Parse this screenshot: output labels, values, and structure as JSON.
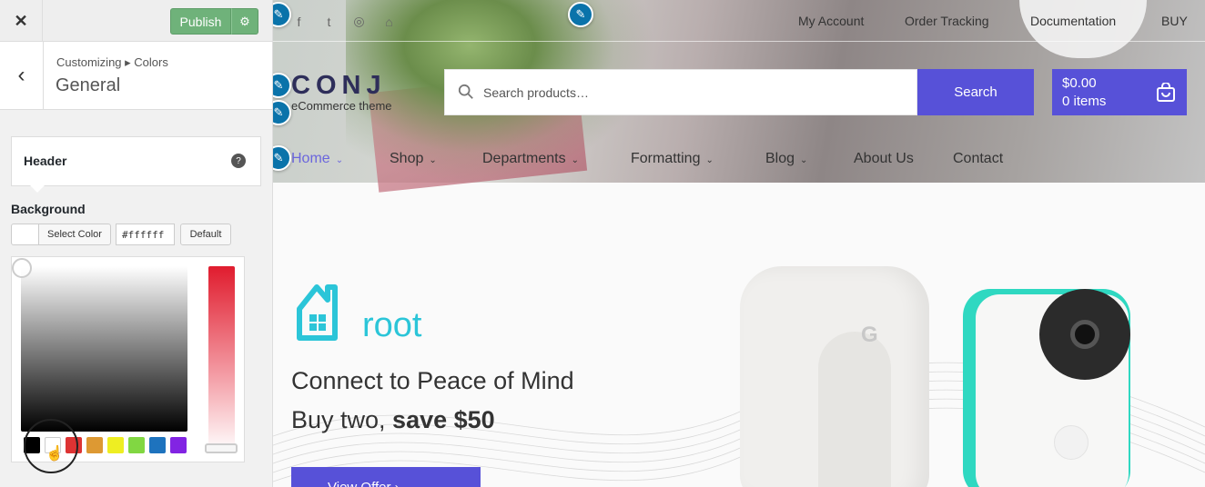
{
  "customizer": {
    "close_glyph": "✕",
    "publish_label": "Publish",
    "settings_glyph": "⚙",
    "back_glyph": "‹",
    "breadcrumb": "Customizing ▸ Colors",
    "section_title": "General",
    "header_card_label": "Header",
    "header_help_glyph": "?",
    "background_label": "Background",
    "select_color_label": "Select Color",
    "hex_value": "#ffffff",
    "default_label": "Default",
    "palette_colors": [
      "#000000",
      "#ffffff",
      "#dd3333",
      "#dd9933",
      "#eeee22",
      "#81d742",
      "#1e73be",
      "#8224e3"
    ]
  },
  "site": {
    "logo": "CONJ",
    "tagline": "eCommerce theme",
    "top_links": [
      "My Account",
      "Order Tracking",
      "Documentation",
      "BUY"
    ],
    "search_placeholder": "Search products…",
    "search_button": "Search",
    "cart_total": "$0.00",
    "cart_count": "0 items",
    "nav": [
      {
        "label": "Home"
      },
      {
        "label": "Shop"
      },
      {
        "label": "Departments"
      },
      {
        "label": "Formatting"
      },
      {
        "label": "Blog"
      },
      {
        "label": "About Us"
      },
      {
        "label": "Contact"
      }
    ],
    "nav_caret": "⌄",
    "brand_word": "root",
    "headline": "Connect to Peace of Mind",
    "subhead_prefix": "Buy two, ",
    "subhead_bold": "save $50",
    "offer_button": "View Offer  ›",
    "device_logo": "G",
    "social_icons": [
      "facebook-icon",
      "twitter-icon",
      "instagram-icon",
      "github-icon"
    ],
    "social_glyphs": [
      "f",
      "t",
      "◎",
      "⌂"
    ],
    "edit_glyph": "✎",
    "accent_color": "#5751d8"
  }
}
